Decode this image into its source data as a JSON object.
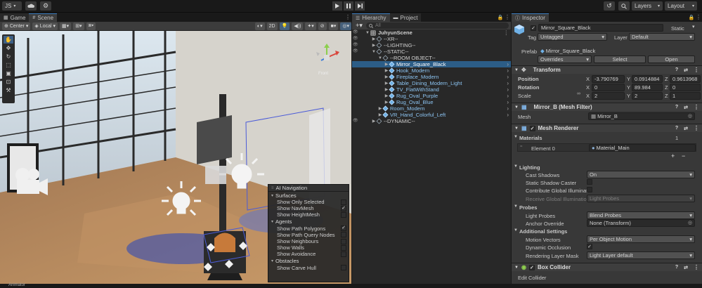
{
  "topbar": {
    "account": "JS",
    "layers": "Layers",
    "layout": "Layout"
  },
  "scene_tabs": {
    "game": "Game",
    "scene": "Scene"
  },
  "scene_toolbar": {
    "pivot": "Center",
    "space": "Local",
    "mode_2d": "2D"
  },
  "scene_view": {
    "orientation_label": "Front"
  },
  "ai_nav": {
    "title": "AI Navigation",
    "sections": [
      {
        "name": "Surfaces",
        "items": [
          {
            "label": "Show Only Selected",
            "checked": false
          },
          {
            "label": "Show NavMesh",
            "checked": true
          },
          {
            "label": "Show HeightMesh",
            "checked": false
          }
        ]
      },
      {
        "name": "Agents",
        "items": [
          {
            "label": "Show Path Polygons",
            "checked": true
          },
          {
            "label": "Show Path Query Nodes",
            "checked": false
          },
          {
            "label": "Show Neighbours",
            "checked": false
          },
          {
            "label": "Show Walls",
            "checked": false
          },
          {
            "label": "Show Avoidance",
            "checked": false
          }
        ]
      },
      {
        "name": "Obstacles",
        "items": [
          {
            "label": "Show Carve Hull",
            "checked": false
          }
        ]
      }
    ]
  },
  "hierarchy": {
    "tabs": [
      "Hierarchy",
      "Project"
    ],
    "search_placeholder": "All",
    "items": [
      {
        "label": "JuhyunScene",
        "depth": 0,
        "expanded": true,
        "icon": "scene",
        "selected": false
      },
      {
        "label": "--XR--",
        "depth": 1,
        "expanded": false,
        "icon": "cube",
        "selected": false
      },
      {
        "label": "--LIGHTING--",
        "depth": 1,
        "expanded": false,
        "icon": "cube",
        "selected": false
      },
      {
        "label": "--STATIC--",
        "depth": 1,
        "expanded": true,
        "icon": "cube",
        "selected": false
      },
      {
        "label": "--ROOM OBJECT--",
        "depth": 2,
        "expanded": true,
        "icon": "cube",
        "selected": false
      },
      {
        "label": "Mirror_Square_Black",
        "depth": 3,
        "expanded": false,
        "icon": "prefab",
        "selected": true
      },
      {
        "label": "Hook_Modern",
        "depth": 3,
        "expanded": false,
        "icon": "prefab",
        "selected": false
      },
      {
        "label": "Fireplace_Modern",
        "depth": 3,
        "expanded": false,
        "icon": "prefab",
        "selected": false
      },
      {
        "label": "Table_Dining_Modern_Light",
        "depth": 3,
        "expanded": false,
        "icon": "prefab",
        "selected": false
      },
      {
        "label": "TV_FlatWithStand",
        "depth": 3,
        "expanded": false,
        "icon": "prefab",
        "selected": false
      },
      {
        "label": "Rug_Oval_Purple",
        "depth": 3,
        "expanded": false,
        "icon": "prefab",
        "selected": false
      },
      {
        "label": "Rug_Oval_Blue",
        "depth": 3,
        "expanded": false,
        "icon": "prefab",
        "selected": false
      },
      {
        "label": "Room_Modern",
        "depth": 2,
        "expanded": false,
        "icon": "prefab",
        "selected": false
      },
      {
        "label": "VR_Hand_Colorful_Left",
        "depth": 2,
        "expanded": false,
        "icon": "prefab",
        "selected": false
      },
      {
        "label": "--DYNAMIC--",
        "depth": 1,
        "expanded": false,
        "icon": "cube",
        "selected": false
      }
    ]
  },
  "inspector": {
    "tab": "Inspector",
    "object_name": "Mirror_Square_Black",
    "static_label": "Static",
    "tag_label": "Tag",
    "tag_value": "Untagged",
    "layer_label": "Layer",
    "layer_value": "Default",
    "prefab_label": "Prefab",
    "prefab_value": "Mirror_Square_Black",
    "overrides": "Overrides",
    "select": "Select",
    "open": "Open",
    "transform": {
      "title": "Transform",
      "position_label": "Position",
      "position": {
        "x": "-3.790769",
        "y": "0.0914884",
        "z": "0.9613968"
      },
      "rotation_label": "Rotation",
      "rotation": {
        "x": "0",
        "y": "89.984",
        "z": "0"
      },
      "scale_label": "Scale",
      "scale": {
        "x": "2",
        "y": "2",
        "z": "1"
      }
    },
    "mesh_filter": {
      "title": "Mirror_B (Mesh Filter)",
      "mesh_label": "Mesh",
      "mesh_value": "Mirror_B"
    },
    "mesh_renderer": {
      "title": "Mesh Renderer",
      "materials_label": "Materials",
      "materials_count": "1",
      "element_label": "Element 0",
      "element_value": "Material_Main",
      "lighting_label": "Lighting",
      "cast_shadows_label": "Cast Shadows",
      "cast_shadows_value": "On",
      "static_caster_label": "Static Shadow Caster",
      "contribute_gi_label": "Contribute Global Illuminati",
      "receive_gi_label": "Receive Global Illuminatio",
      "receive_gi_value": "Light Probes",
      "probes_label": "Probes",
      "light_probes_label": "Light Probes",
      "light_probes_value": "Blend Probes",
      "anchor_label": "Anchor Override",
      "anchor_value": "None (Transform)",
      "additional_label": "Additional Settings",
      "motion_vectors_label": "Motion Vectors",
      "motion_vectors_value": "Per Object Motion",
      "dynamic_occlusion_label": "Dynamic Occlusion",
      "rendering_layer_label": "Rendering Layer Mask",
      "rendering_layer_value": "Light Layer default"
    },
    "box_collider": {
      "title": "Box Collider",
      "edit_label": "Edit Collider"
    }
  },
  "bottom": {
    "animator": "Animator"
  },
  "colors": {
    "selection": "#2c5d87",
    "accent": "#3a79bb",
    "prefab_blue": "#6fb1e6"
  }
}
